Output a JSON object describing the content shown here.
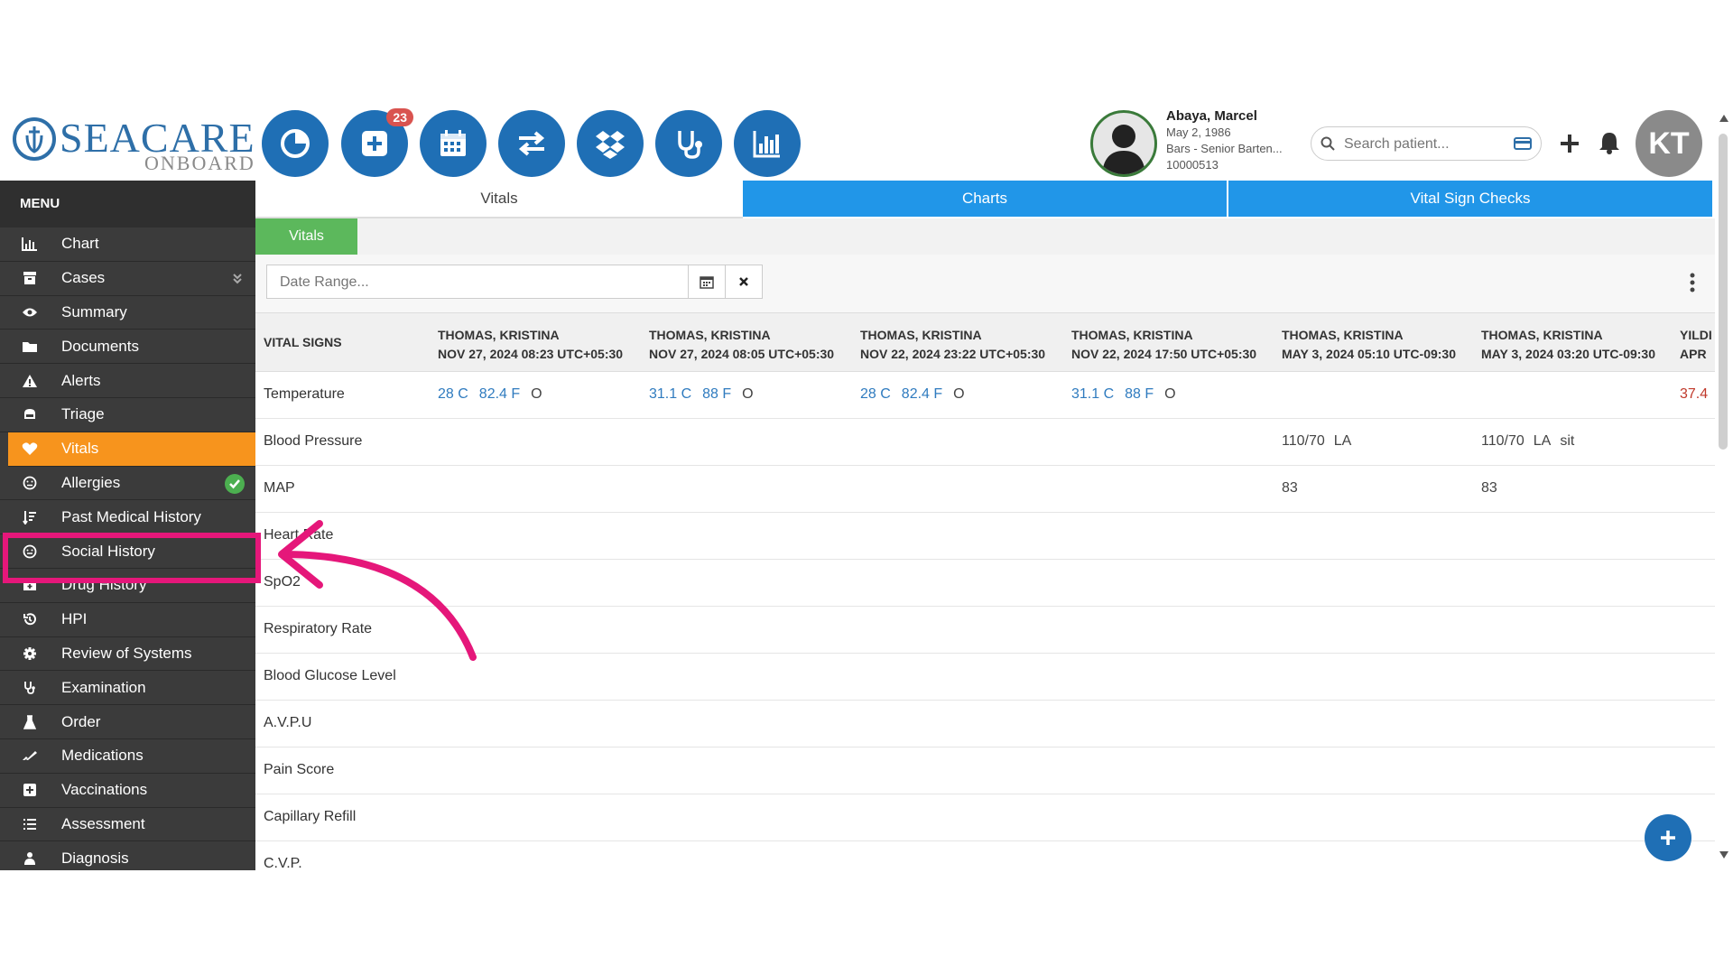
{
  "header": {
    "logo_main": "SEACARE",
    "logo_sub": "ONBOARD",
    "toolbar_badge": "23",
    "patient": {
      "name": "Abaya, Marcel",
      "dob": "May 2, 1986",
      "role": "Bars - Senior Barten...",
      "id": "10000513"
    },
    "search_placeholder": "Search patient...",
    "avatar_initials": "KT"
  },
  "sidebar": {
    "title": "MENU",
    "items": [
      {
        "label": "Chart",
        "icon": "bar-chart-icon"
      },
      {
        "label": "Cases",
        "icon": "archive-icon"
      },
      {
        "label": "Summary",
        "icon": "eye-icon"
      },
      {
        "label": "Documents",
        "icon": "folder-icon"
      },
      {
        "label": "Alerts",
        "icon": "warning-icon"
      },
      {
        "label": "Triage",
        "icon": "triage-icon"
      },
      {
        "label": "Vitals",
        "icon": "heart-icon"
      },
      {
        "label": "Allergies",
        "icon": "face-icon"
      },
      {
        "label": "Past Medical History",
        "icon": "sort-icon"
      },
      {
        "label": "Social History",
        "icon": "smile-icon"
      },
      {
        "label": "Drug History",
        "icon": "briefcase-medical-icon"
      },
      {
        "label": "HPI",
        "icon": "history-icon"
      },
      {
        "label": "Review of Systems",
        "icon": "cog-icon"
      },
      {
        "label": "Examination",
        "icon": "stethoscope-icon"
      },
      {
        "label": "Order",
        "icon": "flask-icon"
      },
      {
        "label": "Medications",
        "icon": "pills-icon"
      },
      {
        "label": "Vaccinations",
        "icon": "plus-square-icon"
      },
      {
        "label": "Assessment",
        "icon": "list-icon"
      },
      {
        "label": "Diagnosis",
        "icon": "user-md-icon"
      }
    ]
  },
  "tabs": [
    "Vitals",
    "Charts",
    "Vital Sign Checks"
  ],
  "subtab": "Vitals",
  "filter": {
    "date_placeholder": "Date Range..."
  },
  "table": {
    "header_label": "VITAL SIGNS",
    "columns": [
      {
        "user": "THOMAS, KRISTINA",
        "date": "NOV 27, 2024 08:23 UTC+05:30"
      },
      {
        "user": "THOMAS, KRISTINA",
        "date": "NOV 27, 2024 08:05 UTC+05:30"
      },
      {
        "user": "THOMAS, KRISTINA",
        "date": "NOV 22, 2024 23:22 UTC+05:30"
      },
      {
        "user": "THOMAS, KRISTINA",
        "date": "NOV 22, 2024 17:50 UTC+05:30"
      },
      {
        "user": "THOMAS, KRISTINA",
        "date": "MAY 3, 2024 05:10 UTC-09:30"
      },
      {
        "user": "THOMAS, KRISTINA",
        "date": "MAY 3, 2024 03:20 UTC-09:30"
      },
      {
        "user": "YILDI",
        "date": "APR"
      }
    ],
    "rows": [
      {
        "label": "Temperature",
        "cells": [
          {
            "c": "28 C",
            "f": "82.4 F",
            "s": "O"
          },
          {
            "c": "31.1 C",
            "f": "88 F",
            "s": "O"
          },
          {
            "c": "28 C",
            "f": "82.4 F",
            "s": "O"
          },
          {
            "c": "31.1 C",
            "f": "88 F",
            "s": "O"
          },
          null,
          null,
          {
            "c": "37.4"
          }
        ]
      },
      {
        "label": "Blood Pressure",
        "cells": [
          null,
          null,
          null,
          null,
          {
            "bp": "110/70",
            "side": "LA",
            "pos": ""
          },
          {
            "bp": "110/70",
            "side": "LA",
            "pos": "sit"
          },
          null
        ]
      },
      {
        "label": "MAP",
        "cells": [
          null,
          null,
          null,
          null,
          {
            "val": "83"
          },
          {
            "val": "83"
          },
          null
        ]
      },
      {
        "label": "Heart Rate"
      },
      {
        "label": "SpO2"
      },
      {
        "label": "Respiratory Rate"
      },
      {
        "label": "Blood Glucose Level"
      },
      {
        "label": "A.V.P.U"
      },
      {
        "label": "Pain Score"
      },
      {
        "label": "Capillary Refill"
      },
      {
        "label": "C.V.P."
      }
    ]
  }
}
